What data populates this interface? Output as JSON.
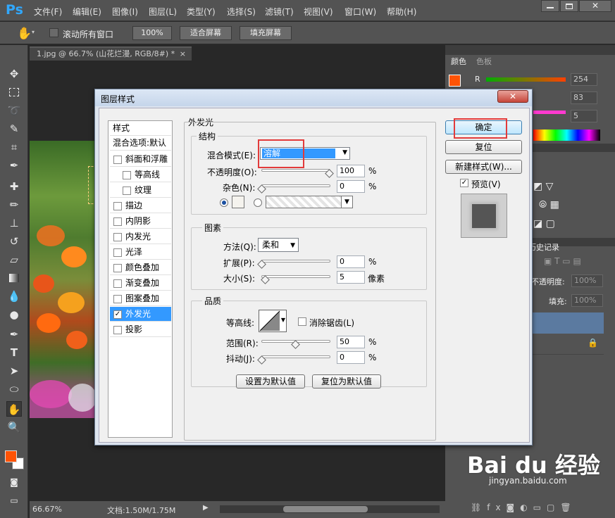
{
  "app": {
    "logo": "Ps"
  },
  "menu": [
    "文件(F)",
    "编辑(E)",
    "图像(I)",
    "图层(L)",
    "类型(Y)",
    "选择(S)",
    "滤镜(T)",
    "视图(V)",
    "窗口(W)",
    "帮助(H)"
  ],
  "options": {
    "scroll_all": "滚动所有窗口",
    "zoom": "100%",
    "fit_screen": "适合屏幕",
    "fill_screen": "填充屏幕"
  },
  "document": {
    "tab": "1.jpg @ 66.7% (山花烂漫, RGB/8#) *",
    "zoom": "66.67%",
    "doc_info": "文档:1.50M/1.75M"
  },
  "panels": {
    "color_tab": "颜色",
    "swatches_tab": "色板",
    "r_label": "R",
    "r_value": "254",
    "g_value": "83",
    "b_value": "5",
    "history_tab": "历史记录",
    "opacity_label": "不透明度:",
    "opacity_value": "100%",
    "fill_label": "填充:",
    "fill_value": "100%"
  },
  "dialog": {
    "title": "图层样式",
    "styles_header": "样式",
    "blend_default": "混合选项:默认",
    "style_items": [
      {
        "label": "斜面和浮雕",
        "checked": false,
        "indent": false
      },
      {
        "label": "等高线",
        "checked": false,
        "indent": true
      },
      {
        "label": "纹理",
        "checked": false,
        "indent": true
      },
      {
        "label": "描边",
        "checked": false,
        "indent": false
      },
      {
        "label": "内阴影",
        "checked": false,
        "indent": false
      },
      {
        "label": "内发光",
        "checked": false,
        "indent": false
      },
      {
        "label": "光泽",
        "checked": false,
        "indent": false
      },
      {
        "label": "颜色叠加",
        "checked": false,
        "indent": false
      },
      {
        "label": "渐变叠加",
        "checked": false,
        "indent": false
      },
      {
        "label": "图案叠加",
        "checked": false,
        "indent": false
      },
      {
        "label": "外发光",
        "checked": true,
        "indent": false,
        "selected": true
      },
      {
        "label": "投影",
        "checked": false,
        "indent": false
      }
    ],
    "section_title": "外发光",
    "structure": {
      "title": "结构",
      "blend_mode_label": "混合模式(E):",
      "blend_mode_value": "溶解",
      "opacity_label": "不透明度(O):",
      "opacity_value": "100",
      "noise_label": "杂色(N):",
      "noise_value": "0",
      "percent": "%",
      "glow_color": "#f5f3ee",
      "opacity_level": 1.0,
      "noise_level": 0.0
    },
    "elements": {
      "title": "图素",
      "method_label": "方法(Q):",
      "method_value": "柔和",
      "spread_label": "扩展(P):",
      "spread_value": "0",
      "size_label": "大小(S):",
      "size_value": "5",
      "px_unit": "像素",
      "percent": "%",
      "spread_level": 0.0,
      "size_level": 0.05
    },
    "quality": {
      "title": "品质",
      "contour_label": "等高线:",
      "antialias_label": "消除锯齿(L)",
      "range_label": "范围(R):",
      "range_value": "50",
      "jitter_label": "抖动(J):",
      "jitter_value": "0",
      "percent": "%",
      "range_level": 0.5,
      "jitter_level": 0.0
    },
    "make_default": "设置为默认值",
    "reset_default": "复位为默认值",
    "ok": "确定",
    "reset": "复位",
    "new_style": "新建样式(W)...",
    "preview": "预览(V)"
  },
  "watermark": {
    "logo": "Bai du 经验",
    "url": "jingyan.baidu.com"
  },
  "colors": {
    "foreground": "#fe5305",
    "accent_blue": "#3399ff",
    "highlight": "#e23b3b"
  }
}
